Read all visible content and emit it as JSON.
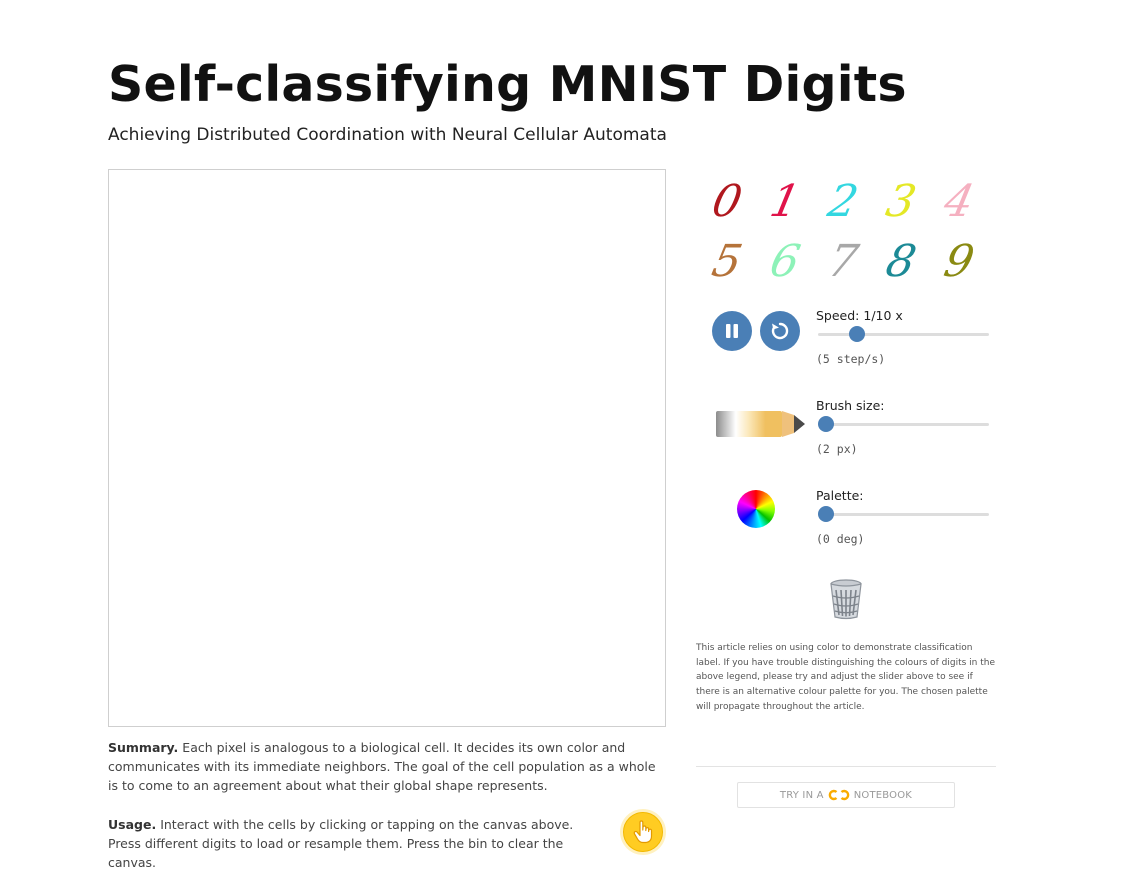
{
  "header": {
    "title": "Self-classifying MNIST Digits",
    "subtitle": "Achieving Distributed Coordination with Neural Cellular Automata"
  },
  "digits": [
    {
      "label": "0",
      "color": "#b0181e"
    },
    {
      "label": "1",
      "color": "#e0134a"
    },
    {
      "label": "2",
      "color": "#33d7e0"
    },
    {
      "label": "3",
      "color": "#e4e826"
    },
    {
      "label": "4",
      "color": "#f5b0c0"
    },
    {
      "label": "5",
      "color": "#b5733a"
    },
    {
      "label": "6",
      "color": "#8df2b8"
    },
    {
      "label": "7",
      "color": "#a8a8a8"
    },
    {
      "label": "8",
      "color": "#1c8a96"
    },
    {
      "label": "9",
      "color": "#8a8a12"
    }
  ],
  "controls": {
    "pause_icon": "pause-icon",
    "reset_icon": "reset-icon",
    "speed": {
      "label": "Speed: 1/10 x",
      "value": "(5 step/s)",
      "position": 0.2
    },
    "brush": {
      "label": "Brush size:",
      "value": "(2 px)",
      "position": 0.0
    },
    "palette": {
      "label": "Palette:",
      "value": "(0 deg)",
      "position": 0.0
    },
    "accent_color": "#4a7fb6"
  },
  "note": "This article relies on using color to demonstrate classification label. If you have trouble distinguishing the colours of digits in the above legend, please try and adjust the slider above to see if there is an alternative colour palette for you. The chosen palette will propagate throughout the article.",
  "summary": {
    "heading": "Summary.",
    "text": "Each pixel is analogous to a biological cell. It decides its own color and communicates with its immediate neighbors. The goal of the cell population as a whole is to come to an agreement about what their global shape represents."
  },
  "usage": {
    "heading": "Usage.",
    "text": "Interact with the cells by clicking or tapping on the canvas above. Press different digits to load or resample them. Press the bin to clear the canvas."
  },
  "colab": {
    "prefix": "TRY IN A",
    "suffix": "NOTEBOOK"
  }
}
